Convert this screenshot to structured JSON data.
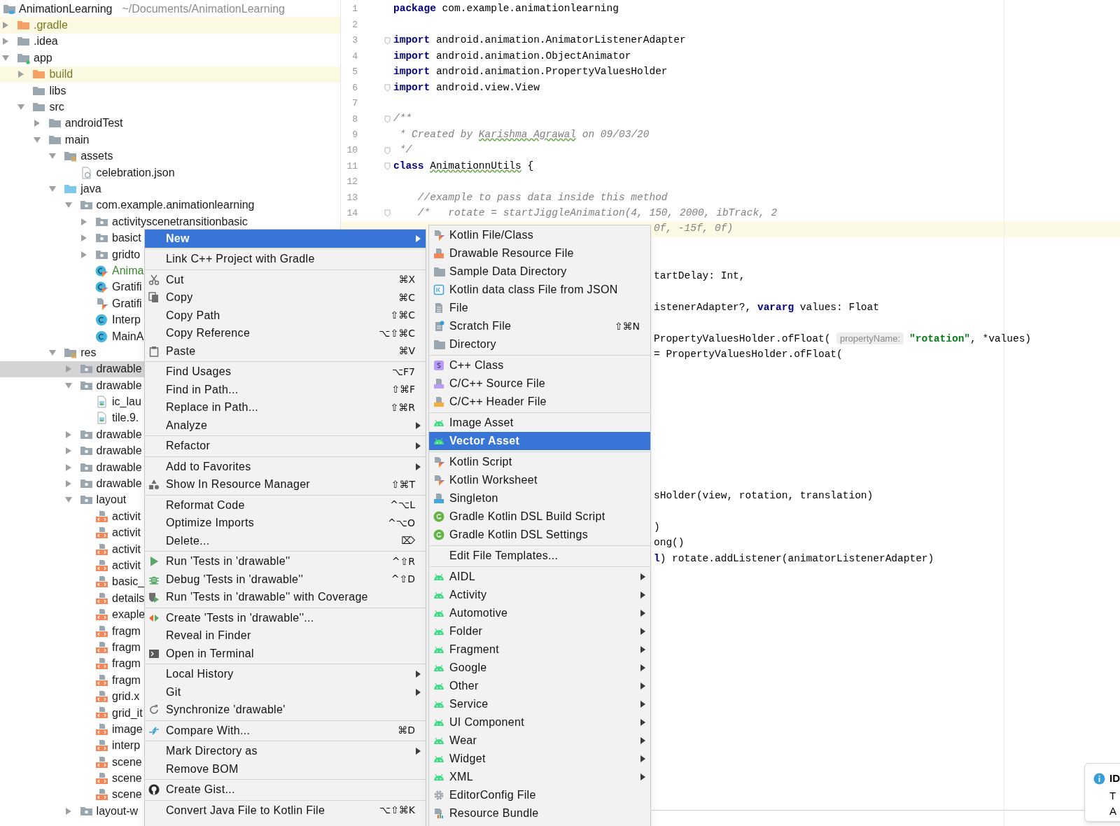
{
  "project_tree": {
    "root": {
      "label": "AnimationLearning",
      "path": "~/Documents/AnimationLearning"
    },
    "children": [
      {
        "label": ".gradle",
        "kind": "folder",
        "excluded": true,
        "expanded": false,
        "selected": false
      },
      {
        "label": ".idea",
        "kind": "folder",
        "expanded": false,
        "selected": false
      },
      {
        "label": "app",
        "kind": "module",
        "expanded": true,
        "selected": false,
        "children": [
          {
            "label": "build",
            "kind": "folder",
            "excluded": true,
            "expanded": false,
            "selected": false
          },
          {
            "label": "libs",
            "kind": "folder",
            "selected": false
          },
          {
            "label": "src",
            "kind": "folder",
            "expanded": true,
            "selected": false,
            "children": [
              {
                "label": "androidTest",
                "kind": "folder",
                "expanded": false,
                "selected": false
              },
              {
                "label": "main",
                "kind": "folder",
                "expanded": true,
                "selected": false,
                "children": [
                  {
                    "label": "assets",
                    "kind": "resources",
                    "expanded": true,
                    "selected": false,
                    "children": [
                      {
                        "label": "celebration.json",
                        "kind": "json",
                        "selected": false
                      }
                    ]
                  },
                  {
                    "label": "java",
                    "kind": "sources",
                    "expanded": true,
                    "selected": false,
                    "children": [
                      {
                        "label": "com.example.animationlearning",
                        "kind": "package",
                        "expanded": true,
                        "selected": false,
                        "children": [
                          {
                            "label": "activityscenetransitionbasic",
                            "kind": "package",
                            "expanded": false,
                            "selected": false
                          },
                          {
                            "label": "basict",
                            "kind": "package",
                            "expanded": false,
                            "selected": false
                          },
                          {
                            "label": "gridto",
                            "kind": "package",
                            "expanded": false,
                            "selected": false
                          },
                          {
                            "label": "Anima",
                            "kind": "kclass",
                            "added": true,
                            "selected": false
                          },
                          {
                            "label": "Gratifi",
                            "kind": "kclass",
                            "selected": false
                          },
                          {
                            "label": "Gratifi",
                            "kind": "kfile",
                            "selected": false
                          },
                          {
                            "label": "Interp",
                            "kind": "jclass",
                            "selected": false
                          },
                          {
                            "label": "MainA",
                            "kind": "jclass",
                            "selected": false
                          }
                        ]
                      }
                    ]
                  },
                  {
                    "label": "res",
                    "kind": "resources",
                    "expanded": true,
                    "selected": false,
                    "children": [
                      {
                        "label": "drawable",
                        "kind": "package",
                        "expanded": false,
                        "selected": true
                      },
                      {
                        "label": "drawable",
                        "kind": "package",
                        "expanded": true,
                        "selected": false,
                        "children": [
                          {
                            "label": "ic_lau",
                            "kind": "image",
                            "selected": false
                          },
                          {
                            "label": "tile.9.",
                            "kind": "image",
                            "selected": false
                          }
                        ]
                      },
                      {
                        "label": "drawable",
                        "kind": "package",
                        "expanded": false,
                        "selected": false
                      },
                      {
                        "label": "drawable",
                        "kind": "package",
                        "expanded": false,
                        "selected": false
                      },
                      {
                        "label": "drawable",
                        "kind": "package",
                        "expanded": false,
                        "selected": false
                      },
                      {
                        "label": "drawable",
                        "kind": "package",
                        "expanded": false,
                        "selected": false
                      },
                      {
                        "label": "layout",
                        "kind": "package",
                        "expanded": true,
                        "selected": false,
                        "children": [
                          {
                            "label": "activit",
                            "kind": "layout",
                            "selected": false
                          },
                          {
                            "label": "activit",
                            "kind": "layout",
                            "selected": false
                          },
                          {
                            "label": "activit",
                            "kind": "layout",
                            "selected": false
                          },
                          {
                            "label": "activit",
                            "kind": "layout",
                            "selected": false
                          },
                          {
                            "label": "basic_",
                            "kind": "layout",
                            "selected": false
                          },
                          {
                            "label": "details",
                            "kind": "layout",
                            "selected": false
                          },
                          {
                            "label": "exaple",
                            "kind": "layout",
                            "selected": false
                          },
                          {
                            "label": "fragm",
                            "kind": "layout",
                            "selected": false
                          },
                          {
                            "label": "fragm",
                            "kind": "layout",
                            "selected": false
                          },
                          {
                            "label": "fragm",
                            "kind": "layout",
                            "selected": false
                          },
                          {
                            "label": "fragm",
                            "kind": "layout",
                            "selected": false
                          },
                          {
                            "label": "grid.x",
                            "kind": "layout",
                            "selected": false
                          },
                          {
                            "label": "grid_it",
                            "kind": "layout",
                            "selected": false
                          },
                          {
                            "label": "image",
                            "kind": "layout",
                            "selected": false
                          },
                          {
                            "label": "interp",
                            "kind": "layout",
                            "selected": false
                          },
                          {
                            "label": "scene",
                            "kind": "layout",
                            "selected": false
                          },
                          {
                            "label": "scene",
                            "kind": "layout",
                            "selected": false
                          },
                          {
                            "label": "scene",
                            "kind": "layout",
                            "selected": false
                          }
                        ]
                      },
                      {
                        "label": "layout-w",
                        "kind": "package",
                        "expanded": false,
                        "selected": false
                      }
                    ]
                  }
                ]
              }
            ]
          }
        ]
      }
    ]
  },
  "editor": {
    "lines": [
      {
        "kind": "numbered",
        "number": "1",
        "fold": false,
        "current": false,
        "segments": [
          {
            "kind": "keyword",
            "text": "package"
          },
          {
            "kind": "plain",
            "text": " com.example.animationlearning"
          }
        ]
      },
      {
        "kind": "numbered",
        "number": "2",
        "fold": false,
        "current": false
      },
      {
        "kind": "numbered",
        "number": "3",
        "fold": true,
        "current": false,
        "segments": [
          {
            "kind": "keyword",
            "text": "import"
          },
          {
            "kind": "plain",
            "text": " android.animation.AnimatorListenerAdapter"
          }
        ]
      },
      {
        "kind": "numbered",
        "number": "4",
        "fold": false,
        "current": false,
        "segments": [
          {
            "kind": "keyword",
            "text": "import"
          },
          {
            "kind": "plain",
            "text": " android.animation.ObjectAnimator"
          }
        ]
      },
      {
        "kind": "numbered",
        "number": "5",
        "fold": false,
        "current": false,
        "segments": [
          {
            "kind": "keyword",
            "text": "import"
          },
          {
            "kind": "plain",
            "text": " android.animation.PropertyValuesHolder"
          }
        ]
      },
      {
        "kind": "numbered",
        "number": "6",
        "fold": true,
        "current": false,
        "segments": [
          {
            "kind": "keyword",
            "text": "import"
          },
          {
            "kind": "plain",
            "text": " android.view.View"
          }
        ]
      },
      {
        "kind": "numbered",
        "number": "7",
        "fold": false,
        "current": false
      },
      {
        "kind": "numbered",
        "number": "8",
        "fold": true,
        "current": false,
        "segments": [
          {
            "kind": "comment",
            "text": "/**"
          }
        ]
      },
      {
        "kind": "numbered",
        "number": "9",
        "fold": false,
        "current": false,
        "segments": [
          {
            "kind": "comment",
            "text": " * Created by "
          },
          {
            "kind": "comment-typo",
            "text": "Karishma Agrawal"
          },
          {
            "kind": "comment",
            "text": " on 09/03/20"
          }
        ]
      },
      {
        "kind": "numbered",
        "number": "10",
        "fold": true,
        "current": false,
        "segments": [
          {
            "kind": "comment",
            "text": " */"
          }
        ]
      },
      {
        "kind": "numbered",
        "number": "11",
        "fold": true,
        "current": false,
        "segments": [
          {
            "kind": "keyword",
            "text": "class "
          },
          {
            "kind": "typo",
            "text": "AnimationnUtils"
          },
          {
            "kind": "plain",
            "text": " {"
          }
        ]
      },
      {
        "kind": "numbered",
        "number": "12",
        "fold": false,
        "current": false
      },
      {
        "kind": "numbered",
        "number": "13",
        "fold": false,
        "current": false,
        "segments": [
          {
            "kind": "comment",
            "text": "    //example to pass data inside this method"
          }
        ]
      },
      {
        "kind": "numbered",
        "number": "14",
        "fold": true,
        "current": false,
        "segments": [
          {
            "kind": "comment",
            "text": "    /*   rotate = startJiggleAnimation(4, 150, 2000, ibTrack, 2"
          }
        ]
      },
      {
        "kind": "partial",
        "current": true,
        "segments": [
          {
            "kind": "comment",
            "text": "0f, -15f, 0f)"
          }
        ]
      },
      {
        "kind": "blank",
        "current": false
      },
      {
        "kind": "blank",
        "current": false
      },
      {
        "kind": "partial",
        "current": false,
        "segments": [
          {
            "kind": "plain",
            "text": "tartDelay: Int,"
          }
        ]
      },
      {
        "kind": "blank",
        "current": false
      },
      {
        "kind": "partial",
        "current": false,
        "segments": [
          {
            "kind": "plain",
            "text": "istenerAdapter?, "
          },
          {
            "kind": "keyword",
            "text": "vararg"
          },
          {
            "kind": "plain",
            "text": " values: Float"
          }
        ]
      },
      {
        "kind": "blank",
        "current": false
      },
      {
        "kind": "partial",
        "current": false,
        "segments": [
          {
            "kind": "plain",
            "text": "PropertyValuesHolder.ofFloat( "
          },
          {
            "kind": "hint",
            "text": "propertyName:"
          },
          {
            "kind": "string",
            "text": "\"rotation\""
          },
          {
            "kind": "plain",
            "text": ", *values)"
          }
        ]
      },
      {
        "kind": "partial",
        "current": false,
        "segments": [
          {
            "kind": "plain",
            "text": "= PropertyValuesHolder.ofFloat("
          }
        ]
      },
      {
        "kind": "blank",
        "current": false
      },
      {
        "kind": "blank",
        "current": false
      },
      {
        "kind": "blank",
        "current": false
      },
      {
        "kind": "blank",
        "current": false
      },
      {
        "kind": "blank",
        "current": false
      },
      {
        "kind": "blank",
        "current": false
      },
      {
        "kind": "blank",
        "current": false
      },
      {
        "kind": "blank",
        "current": false
      },
      {
        "kind": "partial",
        "current": false,
        "segments": [
          {
            "kind": "plain",
            "text": "sHolder(view, rotation, translation)"
          }
        ]
      },
      {
        "kind": "blank",
        "current": false
      },
      {
        "kind": "partial",
        "current": false,
        "segments": [
          {
            "kind": "plain",
            "text": ")"
          }
        ]
      },
      {
        "kind": "partial",
        "current": false,
        "segments": [
          {
            "kind": "plain",
            "text": "ong()"
          }
        ]
      },
      {
        "kind": "partial",
        "current": false,
        "segments": [
          {
            "kind": "keyword",
            "text": "l"
          },
          {
            "kind": "plain",
            "text": ") rotate.addListener(animatorListenerAdapter)"
          }
        ]
      }
    ]
  },
  "context_menu": {
    "groups": [
      {
        "items": [
          {
            "label": "New",
            "arrow": true,
            "selected": true
          }
        ]
      },
      {
        "items": [
          {
            "label": "Link C++ Project with Gradle",
            "arrow": false,
            "selected": false
          }
        ]
      },
      {
        "items": [
          {
            "label": "Cut",
            "kind": "cut",
            "shortcut": "⌘X",
            "arrow": false,
            "selected": false
          },
          {
            "label": "Copy",
            "kind": "copy",
            "shortcut": "⌘C",
            "arrow": false,
            "selected": false
          },
          {
            "label": "Copy Path",
            "shortcut": "⇧⌘C",
            "arrow": false,
            "selected": false
          },
          {
            "label": "Copy Reference",
            "shortcut": "⌥⇧⌘C",
            "arrow": false,
            "selected": false
          },
          {
            "label": "Paste",
            "kind": "paste",
            "shortcut": "⌘V",
            "arrow": false,
            "selected": false
          }
        ]
      },
      {
        "items": [
          {
            "label": "Find Usages",
            "shortcut": "⌥F7",
            "arrow": false,
            "selected": false
          },
          {
            "label": "Find in Path...",
            "shortcut": "⇧⌘F",
            "arrow": false,
            "selected": false
          },
          {
            "label": "Replace in Path...",
            "shortcut": "⇧⌘R",
            "arrow": false,
            "selected": false
          },
          {
            "label": "Analyze",
            "arrow": true,
            "selected": false
          }
        ]
      },
      {
        "items": [
          {
            "label": "Refactor",
            "arrow": true,
            "selected": false
          }
        ]
      },
      {
        "items": [
          {
            "label": "Add to Favorites",
            "arrow": true,
            "selected": false
          },
          {
            "label": "Show In Resource Manager",
            "kind": "resources",
            "shortcut": "⇧⌘T",
            "arrow": false,
            "selected": false
          }
        ]
      },
      {
        "items": [
          {
            "label": "Reformat Code",
            "shortcut": "^⌥L",
            "arrow": false,
            "selected": false
          },
          {
            "label": "Optimize Imports",
            "shortcut": "^⌥O",
            "arrow": false,
            "selected": false
          },
          {
            "label": "Delete...",
            "shortcut": "⌦",
            "arrow": false,
            "selected": false
          }
        ]
      },
      {
        "items": [
          {
            "label": "Run 'Tests in 'drawable''",
            "kind": "run",
            "shortcut": "^⇧R",
            "arrow": false,
            "selected": false
          },
          {
            "label": "Debug 'Tests in 'drawable''",
            "kind": "debug",
            "shortcut": "^⇧D",
            "arrow": false,
            "selected": false
          },
          {
            "label": "Run 'Tests in 'drawable'' with Coverage",
            "kind": "coverage",
            "arrow": false,
            "selected": false
          }
        ]
      },
      {
        "items": [
          {
            "label": "Create 'Tests in 'drawable''...",
            "kind": "test",
            "arrow": false,
            "selected": false
          },
          {
            "label": "Reveal in Finder",
            "arrow": false,
            "selected": false
          },
          {
            "label": "Open in Terminal",
            "kind": "terminal",
            "arrow": false,
            "selected": false
          }
        ]
      },
      {
        "items": [
          {
            "label": "Local History",
            "arrow": true,
            "selected": false
          },
          {
            "label": "Git",
            "arrow": true,
            "selected": false
          },
          {
            "label": "Synchronize 'drawable'",
            "kind": "sync",
            "arrow": false,
            "selected": false
          }
        ]
      },
      {
        "items": [
          {
            "label": "Compare With...",
            "kind": "compare",
            "shortcut": "⌘D",
            "arrow": false,
            "selected": false
          }
        ]
      },
      {
        "items": [
          {
            "label": "Mark Directory as",
            "arrow": true,
            "selected": false
          },
          {
            "label": "Remove BOM",
            "arrow": false,
            "selected": false
          }
        ]
      },
      {
        "items": [
          {
            "label": "Create Gist...",
            "kind": "gist",
            "arrow": false,
            "selected": false
          }
        ]
      },
      {
        "items": [
          {
            "label": "Convert Java File to Kotlin File",
            "shortcut": "⌥⇧⌘K",
            "arrow": false,
            "selected": false
          }
        ]
      }
    ]
  },
  "new_submenu": {
    "groups": [
      {
        "items": [
          {
            "label": "Kotlin File/Class",
            "kind": "kotlin",
            "arrow": false,
            "selected": false
          },
          {
            "label": "Drawable Resource File",
            "kind": "drawable",
            "arrow": false,
            "selected": false
          },
          {
            "label": "Sample Data Directory",
            "kind": "folder",
            "arrow": false,
            "selected": false
          },
          {
            "label": "Kotlin data class File from JSON",
            "kind": "json",
            "arrow": false,
            "selected": false
          },
          {
            "label": "File",
            "kind": "file",
            "arrow": false,
            "selected": false
          },
          {
            "label": "Scratch File",
            "kind": "scratch",
            "shortcut": "⇧⌘N",
            "arrow": false,
            "selected": false
          },
          {
            "label": "Directory",
            "kind": "folder",
            "arrow": false,
            "selected": false
          }
        ]
      },
      {
        "items": [
          {
            "label": "C++ Class",
            "kind": "cppclass",
            "arrow": false,
            "selected": false
          },
          {
            "label": "C/C++ Source File",
            "kind": "cppsource",
            "arrow": false,
            "selected": false
          },
          {
            "label": "C/C++ Header File",
            "kind": "cppheader",
            "arrow": false,
            "selected": false
          }
        ]
      },
      {
        "items": [
          {
            "label": "Image Asset",
            "kind": "android",
            "arrow": false,
            "selected": false
          },
          {
            "label": "Vector Asset",
            "kind": "android",
            "arrow": false,
            "selected": true
          }
        ]
      },
      {
        "items": [
          {
            "label": "Kotlin Script",
            "kind": "kotlin",
            "arrow": false,
            "selected": false
          },
          {
            "label": "Kotlin Worksheet",
            "kind": "kotlin",
            "arrow": false,
            "selected": false
          },
          {
            "label": "Singleton",
            "kind": "singleton",
            "arrow": false,
            "selected": false
          },
          {
            "label": "Gradle Kotlin DSL Build Script",
            "kind": "gradle",
            "arrow": false,
            "selected": false
          },
          {
            "label": "Gradle Kotlin DSL Settings",
            "kind": "gradle",
            "arrow": false,
            "selected": false
          }
        ]
      },
      {
        "items": [
          {
            "label": "Edit File Templates...",
            "arrow": false,
            "selected": false
          }
        ]
      },
      {
        "items": [
          {
            "label": "AIDL",
            "kind": "android",
            "arrow": true,
            "selected": false
          },
          {
            "label": "Activity",
            "kind": "android",
            "arrow": true,
            "selected": false
          },
          {
            "label": "Automotive",
            "kind": "android",
            "arrow": true,
            "selected": false
          },
          {
            "label": "Folder",
            "kind": "android",
            "arrow": true,
            "selected": false
          },
          {
            "label": "Fragment",
            "kind": "android",
            "arrow": true,
            "selected": false
          },
          {
            "label": "Google",
            "kind": "android",
            "arrow": true,
            "selected": false
          },
          {
            "label": "Other",
            "kind": "android",
            "arrow": true,
            "selected": false
          },
          {
            "label": "Service",
            "kind": "android",
            "arrow": true,
            "selected": false
          },
          {
            "label": "UI Component",
            "kind": "android",
            "arrow": true,
            "selected": false
          },
          {
            "label": "Wear",
            "kind": "android",
            "arrow": true,
            "selected": false
          },
          {
            "label": "Widget",
            "kind": "android",
            "arrow": true,
            "selected": false
          },
          {
            "label": "XML",
            "kind": "android",
            "arrow": true,
            "selected": false
          },
          {
            "label": "EditorConfig File",
            "kind": "config",
            "arrow": false,
            "selected": false
          },
          {
            "label": "Resource Bundle",
            "kind": "bundle",
            "arrow": false,
            "selected": false
          }
        ]
      }
    ]
  },
  "notification": {
    "title": "ID",
    "lines": [
      "T",
      "A"
    ]
  }
}
